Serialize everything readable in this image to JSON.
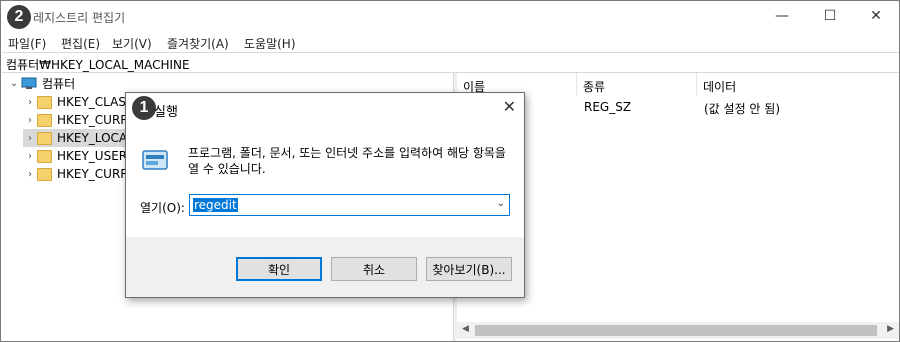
{
  "window": {
    "title": "레지스트리 편집기",
    "badge": "2",
    "controls": {
      "minimize": "—",
      "maximize": "☐",
      "close": "✕"
    }
  },
  "menu": [
    "파일(F)",
    "편집(E)",
    "보기(V)",
    "즐겨찾기(A)",
    "도움말(H)"
  ],
  "address": "컴퓨터₩HKEY_LOCAL_MACHINE",
  "tree": {
    "root": "컴퓨터",
    "items": [
      "HKEY_CLASS",
      "HKEY_CURR",
      "HKEY_LOCA",
      "HKEY_USERS",
      "HKEY_CURR"
    ]
  },
  "list": {
    "columns": [
      "이름",
      "종류",
      "데이터"
    ],
    "row": {
      "name": "",
      "type": "REG_SZ",
      "data": "(값 설정 안 됨)"
    }
  },
  "dialog": {
    "badge": "1",
    "title": "실행",
    "close": "✕",
    "message": "프로그램, 폴더, 문서, 또는 인터넷 주소를 입력하여 해당 항목을 열 수 있습니다.",
    "open_label": "열기(O):",
    "input_value": "regedit",
    "ok_label": "확인",
    "cancel_label": "취소",
    "browse_label": "찾아보기(B)...",
    "accent": "#0078d7"
  }
}
